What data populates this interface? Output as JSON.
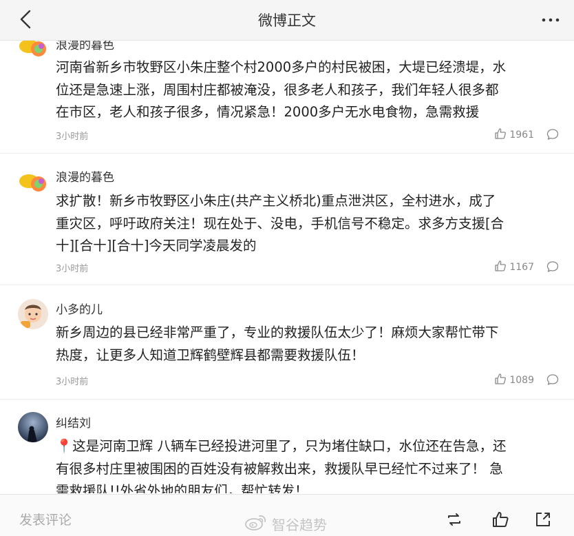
{
  "header": {
    "title": "微博正文"
  },
  "comments": [
    {
      "name": "浪漫的暮色",
      "text": "河南省新乡市牧野区小朱庄整个村2000多户的村民被困，大堤已经溃堤，水\n位还是急速上涨，周围村庄都被淹没，很多老人和孩子，我们年轻人很多都\n在市区，老人和孩子很多，情况紧急！2000多户无水电食物，急需救援",
      "time": "3小时前",
      "likes": "1961"
    },
    {
      "name": "浪漫的暮色",
      "text": "求扩散！新乡市牧野区小朱庄(共产主义桥北)重点泄洪区，全村进水，成了\n重灾区，呼吁政府关注！现在处于、没电，手机信号不稳定。求多方支援[合\n十][合十][合十]今天同学凌晨发的",
      "time": "3小时前",
      "likes": "1167"
    },
    {
      "name": "小多的儿",
      "text": "新乡周边的县已经非常严重了，专业的救援队伍太少了！麻烦大家帮忙带下\n热度，让更多人知道卫辉鹤壁辉县都需要救援队伍！",
      "time": "3小时前",
      "likes": "1089"
    },
    {
      "name": "纠结刘",
      "text": "📍这是河南卫辉 八辆车已经投进河里了，只为堵住缺口，水位还在告急，还\n有很多村庄里被围困的百姓没有被解救出来，救援队早已经忙不过来了！ 急\n需救援队!!外省外地的朋友们，帮忙转发！"
    }
  ],
  "bottom_bar": {
    "comment_placeholder": "发表评论",
    "watermark": "智谷趋势"
  },
  "colors": {
    "header_bg": "#f5f5f5",
    "text": "#222222",
    "meta": "#999999",
    "divider": "#ececec"
  },
  "icons": [
    "back-arrow-icon",
    "more-dots-icon",
    "thumbs-up-icon",
    "comment-bubble-icon",
    "repost-icon",
    "share-icon",
    "weibo-logo-icon"
  ]
}
